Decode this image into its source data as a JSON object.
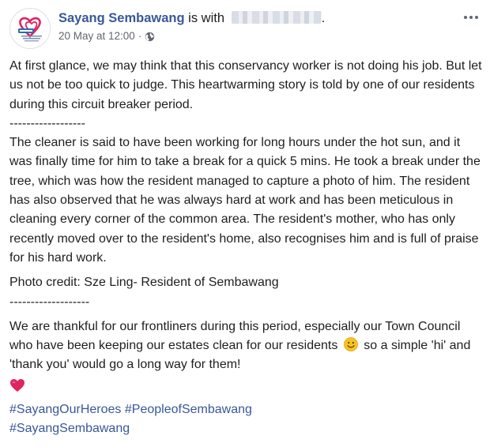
{
  "post": {
    "page_name": "Sayang Sembawang",
    "with_text": " is with ",
    "period": ".",
    "timestamp": "20 May at 12:00",
    "dot": "·",
    "avatar_logo_text": "Sayang Sembawang",
    "privacy_icon": "globe-icon",
    "options_icon": "more-options-icon"
  },
  "content": {
    "para1": "At first glance, we may think that this conservancy worker is not doing his job. But let us not be too quick to judge. This heartwarming story is told by one of our residents during this circuit breaker period.",
    "sep1": "------------------",
    "para2": "The cleaner is said to have been working for long hours under the hot sun, and it was finally time for him to take a break for a quick 5 mins. He took a break under the tree, which was how the resident managed to capture a photo of him. The resident has also observed that he was always hard at work and has been meticulous in cleaning every corner of the common area. The resident's mother, who has only recently moved over to the resident's home, also recognises him and is full of praise for his hard work.",
    "photo_credit": "Photo credit: Sze Ling- Resident of Sembawang",
    "sep2": "-------------------",
    "para3_before": "We are thankful for our frontliners during this period, especially our Town Council who have been keeping our estates clean for our residents",
    "para3_after": "so a simple 'hi' and 'thank you' would go a long way for them!",
    "smile_icon": "smiling-face-emoji",
    "heart_icon": "red-heart-emoji",
    "hashtags": [
      "#SayangOurHeroes",
      "#PeopleofSembawang",
      "#SayangSembawang"
    ]
  },
  "colors": {
    "link": "#385898",
    "text": "#1c1e21",
    "meta": "#606770",
    "heart": "#e0245e"
  }
}
